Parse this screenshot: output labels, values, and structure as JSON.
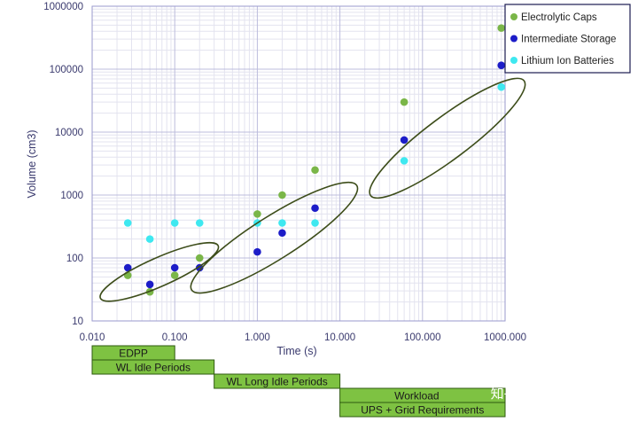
{
  "chart_data": {
    "type": "scatter",
    "title": "",
    "xlabel": "Time (s)",
    "ylabel": "Volume (cm3)",
    "x_scale": "log",
    "y_scale": "log",
    "xlim": [
      0.01,
      1000
    ],
    "ylim": [
      10,
      1000000
    ],
    "x_ticks": [
      "0.010",
      "0.100",
      "1.000",
      "10.000",
      "100.000",
      "1000.000"
    ],
    "y_ticks": [
      "10",
      "100",
      "1000",
      "10000",
      "100000",
      "1000000"
    ],
    "grid": true,
    "legend_position": "top-right",
    "series": [
      {
        "name": "Electrolytic Caps",
        "color": "#7ab648",
        "points": [
          [
            0.027,
            53
          ],
          [
            0.05,
            29
          ],
          [
            0.1,
            53
          ],
          [
            0.2,
            100
          ],
          [
            1,
            500
          ],
          [
            2,
            1000
          ],
          [
            5,
            2500
          ],
          [
            60,
            30000
          ],
          [
            900,
            450000
          ]
        ]
      },
      {
        "name": "Intermediate Storage",
        "color": "#1c1cc8",
        "points": [
          [
            0.027,
            70
          ],
          [
            0.05,
            38
          ],
          [
            0.1,
            70
          ],
          [
            0.2,
            70
          ],
          [
            1,
            125
          ],
          [
            2,
            250
          ],
          [
            5,
            620
          ],
          [
            60,
            7500
          ],
          [
            900,
            115000
          ]
        ]
      },
      {
        "name": "Lithium Ion Batteries",
        "color": "#3ee8f0",
        "points": [
          [
            0.027,
            360
          ],
          [
            0.05,
            200
          ],
          [
            0.1,
            360
          ],
          [
            0.2,
            360
          ],
          [
            1,
            360
          ],
          [
            2,
            360
          ],
          [
            5,
            360
          ],
          [
            60,
            3500
          ],
          [
            900,
            52000
          ]
        ]
      }
    ],
    "ellipses": [
      {
        "center": [
          0.065,
          60
        ],
        "x_range": [
          0.012,
          0.32
        ],
        "y_range": [
          25,
          170
        ],
        "color": "#3d4d1a"
      },
      {
        "center": [
          1.6,
          210
        ],
        "x_range": [
          0.11,
          11
        ],
        "y_range": [
          35,
          1600
        ],
        "color": "#3d4d1a"
      },
      {
        "center": [
          200,
          8000
        ],
        "x_range": [
          18,
          1300
        ],
        "y_range": [
          900,
          60000
        ],
        "color": "#3d4d1a"
      }
    ],
    "bands": [
      {
        "label": "EDPP",
        "x_range": [
          0.01,
          0.1
        ]
      },
      {
        "label": "WL Idle Periods",
        "x_range": [
          0.01,
          0.3
        ]
      },
      {
        "label": "WL Long Idle Periods",
        "x_range": [
          0.3,
          10
        ]
      },
      {
        "label": "Workload",
        "x_range": [
          10,
          1000
        ]
      },
      {
        "label": "UPS + Grid Requirements",
        "x_range": [
          10,
          1000
        ]
      }
    ],
    "band_color": "#7ec242",
    "watermark": "知乎 @人类观察图灵机"
  }
}
